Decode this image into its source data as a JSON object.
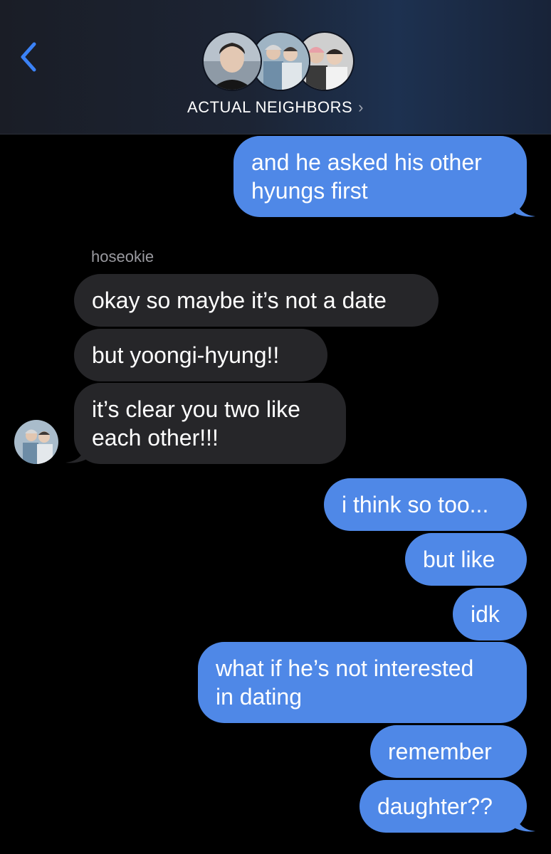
{
  "header": {
    "title": "ACTUAL NEIGHBORS",
    "back_icon": "chevron-left-icon",
    "title_chevron": "›",
    "accent": "#3b82f6"
  },
  "avatars": [
    "person-photo",
    "group-photo",
    "group-photo"
  ],
  "colors": {
    "outgoing": "#4f88e7",
    "incoming": "#262629",
    "background": "#000000",
    "sender_label": "#9a9aa0"
  },
  "messages": [
    {
      "dir": "out",
      "text": "and he asked his other\nhyungs first"
    },
    {
      "dir": "in",
      "sender": "hoseokie",
      "text": "okay so maybe it’s not a date"
    },
    {
      "dir": "in",
      "text": "but yoongi-hyung!!"
    },
    {
      "dir": "in",
      "text": "it’s clear you two like\neach other!!!"
    },
    {
      "dir": "out",
      "text": "i think so too..."
    },
    {
      "dir": "out",
      "text": "but like"
    },
    {
      "dir": "out",
      "text": "idk"
    },
    {
      "dir": "out",
      "text": "what if he’s not interested\nin dating"
    },
    {
      "dir": "out",
      "text": "remember"
    },
    {
      "dir": "out",
      "text": "daughter??"
    }
  ]
}
